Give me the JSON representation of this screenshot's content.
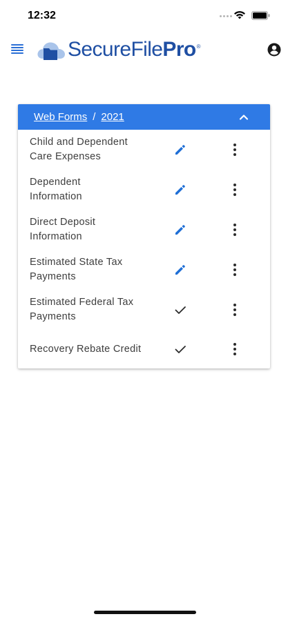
{
  "status_bar": {
    "time": "12:32"
  },
  "header": {
    "logo": {
      "text_regular": "SecureFile",
      "text_bold": "Pro",
      "trademark": "®"
    }
  },
  "card": {
    "breadcrumb": {
      "root": "Web Forms",
      "separator": "/",
      "year": "2021"
    },
    "rows": [
      {
        "line1": "Child and Dependent",
        "line2": "Care Expenses",
        "status_icon": "pencil-edit-icon"
      },
      {
        "line1": "Dependent",
        "line2": "Information",
        "status_icon": "pencil-edit-icon"
      },
      {
        "line1": "Direct Deposit",
        "line2": "Information",
        "status_icon": "pencil-edit-icon"
      },
      {
        "line1": "Estimated State Tax",
        "line2": "Payments",
        "status_icon": "pencil-edit-icon"
      },
      {
        "line1": "Estimated Federal Tax",
        "line2": "Payments",
        "status_icon": "checkmark-icon"
      },
      {
        "line1": "Recovery Rebate Credit",
        "line2": "",
        "status_icon": "checkmark-icon"
      }
    ]
  },
  "colors": {
    "accent": "#2f7ae5",
    "brand": "#1f4fa3",
    "edit_icon": "#1f6fd6",
    "text": "#3d3d3d"
  }
}
